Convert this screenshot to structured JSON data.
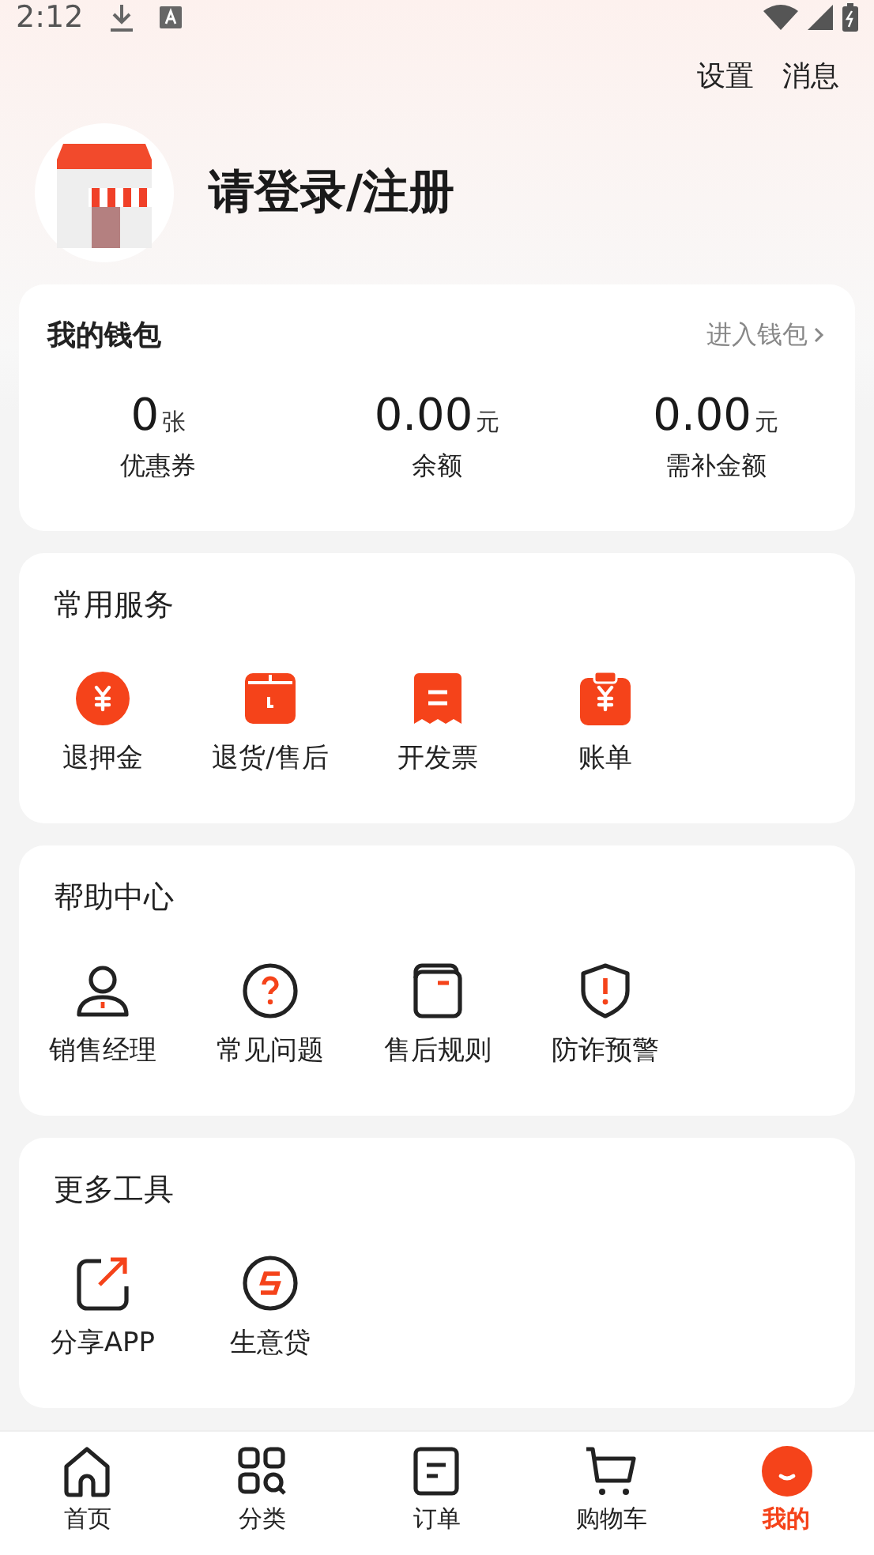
{
  "status_bar": {
    "time": "2:12"
  },
  "header_links": [
    {
      "label": "设置"
    },
    {
      "label": "消息"
    }
  ],
  "profile": {
    "login_text": "请登录/注册"
  },
  "wallet": {
    "title": "我的钱包",
    "link": "进入钱包",
    "items": [
      {
        "value": "0",
        "unit": "张",
        "label": "优惠券"
      },
      {
        "value": "0.00",
        "unit": "元",
        "label": "余额"
      },
      {
        "value": "0.00",
        "unit": "元",
        "label": "需补金额"
      }
    ]
  },
  "sections": [
    {
      "title": "常用服务",
      "items": [
        {
          "label": "退押金"
        },
        {
          "label": "退货/售后"
        },
        {
          "label": "开发票"
        },
        {
          "label": "账单"
        }
      ]
    },
    {
      "title": "帮助中心",
      "items": [
        {
          "label": "销售经理"
        },
        {
          "label": "常见问题"
        },
        {
          "label": "售后规则"
        },
        {
          "label": "防诈预警"
        }
      ]
    },
    {
      "title": "更多工具",
      "items": [
        {
          "label": "分享APP"
        },
        {
          "label": "生意贷"
        }
      ]
    }
  ],
  "bottom_nav": [
    {
      "label": "首页",
      "selected": false
    },
    {
      "label": "分类",
      "selected": false
    },
    {
      "label": "订单",
      "selected": false
    },
    {
      "label": "购物车",
      "selected": false
    },
    {
      "label": "我的",
      "selected": true
    }
  ]
}
